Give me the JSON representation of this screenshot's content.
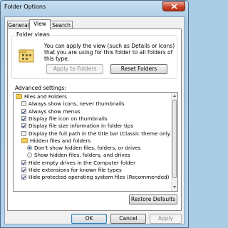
{
  "window": {
    "title": "Folder Options",
    "close_icon": "close-icon"
  },
  "tabs": [
    {
      "label": "General",
      "active": false
    },
    {
      "label": "View",
      "active": true
    },
    {
      "label": "Search",
      "active": false
    }
  ],
  "folder_views": {
    "label": "Folder views",
    "description": "You can apply the view (such as Details or Icons) that you are using for this folder to all folders of this type.",
    "apply_label": "Apply to Folders",
    "reset_label": "Reset Folders"
  },
  "advanced": {
    "label": "Advanced settings:",
    "items": [
      {
        "kind": "folder",
        "indent": 0,
        "label": "Files and Folders"
      },
      {
        "kind": "checkbox",
        "checked": false,
        "indent": 1,
        "label": "Always show icons, never thumbnails"
      },
      {
        "kind": "checkbox",
        "checked": true,
        "indent": 1,
        "label": "Always show menus"
      },
      {
        "kind": "checkbox",
        "checked": true,
        "indent": 1,
        "label": "Display file icon on thumbnails"
      },
      {
        "kind": "checkbox",
        "checked": true,
        "indent": 1,
        "label": "Display file size information in folder tips"
      },
      {
        "kind": "checkbox",
        "checked": false,
        "indent": 1,
        "label": "Display the full path in the title bar (Classic theme only)"
      },
      {
        "kind": "folder",
        "indent": 1,
        "label": "Hidden files and folders"
      },
      {
        "kind": "radio",
        "checked": true,
        "indent": 2,
        "label": "Don't show hidden files, folders, or drives"
      },
      {
        "kind": "radio",
        "checked": false,
        "indent": 2,
        "label": "Show hidden files, folders, and drives"
      },
      {
        "kind": "checkbox",
        "checked": true,
        "indent": 1,
        "label": "Hide empty drives in the Computer folder"
      },
      {
        "kind": "checkbox",
        "checked": true,
        "indent": 1,
        "label": "Hide extensions for known file types"
      },
      {
        "kind": "checkbox",
        "checked": true,
        "indent": 1,
        "label": "Hide protected operating system files (Recommended)"
      }
    ],
    "restore_label": "Restore Defaults"
  },
  "footer": {
    "ok_label": "OK",
    "cancel_label": "Cancel",
    "apply_label": "Apply"
  }
}
